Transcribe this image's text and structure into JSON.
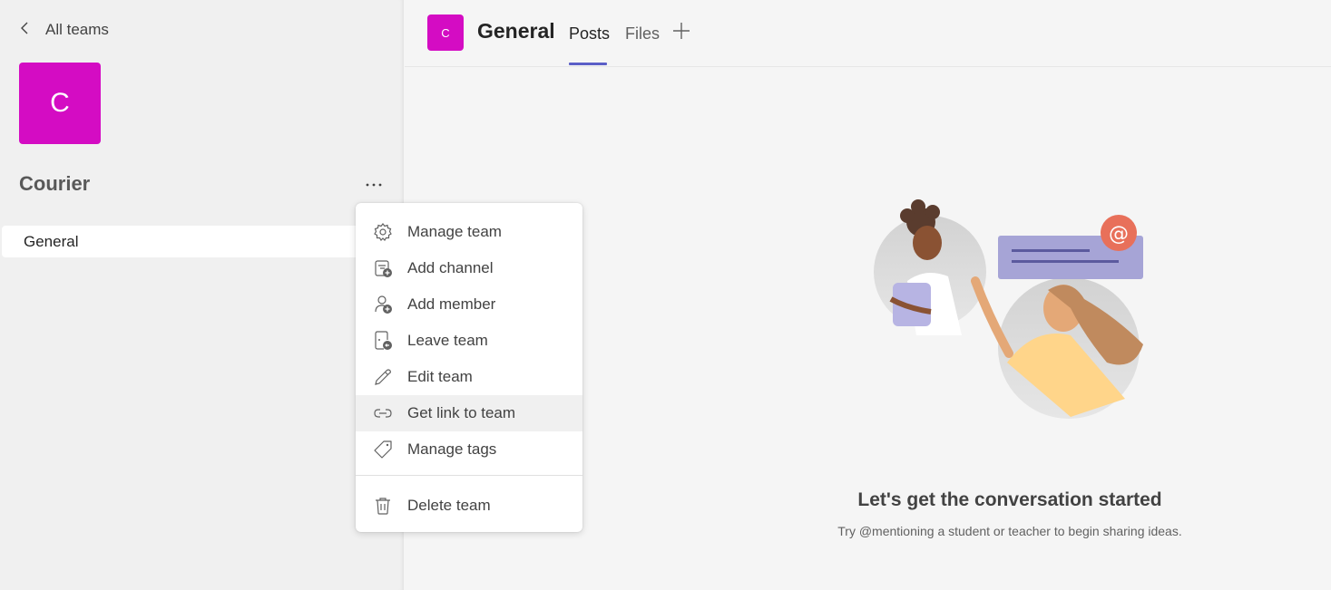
{
  "sidebar": {
    "back_label": "All teams",
    "team_initial": "C",
    "team_name": "Courier",
    "more_label": "···",
    "channels": [
      {
        "label": "General"
      }
    ]
  },
  "header": {
    "channel_initial": "C",
    "channel_title": "General",
    "tabs": [
      {
        "label": "Posts",
        "active": true
      },
      {
        "label": "Files",
        "active": false
      }
    ],
    "add_tab_label": "+"
  },
  "context_menu": {
    "items": [
      {
        "label": "Manage team",
        "icon": "gear-icon"
      },
      {
        "label": "Add channel",
        "icon": "add-channel-icon"
      },
      {
        "label": "Add member",
        "icon": "add-member-icon"
      },
      {
        "label": "Leave team",
        "icon": "leave-team-icon"
      },
      {
        "label": "Edit team",
        "icon": "pencil-icon"
      },
      {
        "label": "Get link to team",
        "icon": "link-icon",
        "hovered": true
      },
      {
        "label": "Manage tags",
        "icon": "tag-icon"
      },
      {
        "label": "Delete team",
        "icon": "trash-icon"
      }
    ]
  },
  "empty_state": {
    "title": "Let's get the conversation started",
    "subtitle": "Try @mentioning a student or teacher to begin sharing ideas."
  },
  "colors": {
    "team_tile": "#d40cc3",
    "tab_accent": "#5b5fc7",
    "mention_badge": "#e8705a"
  }
}
